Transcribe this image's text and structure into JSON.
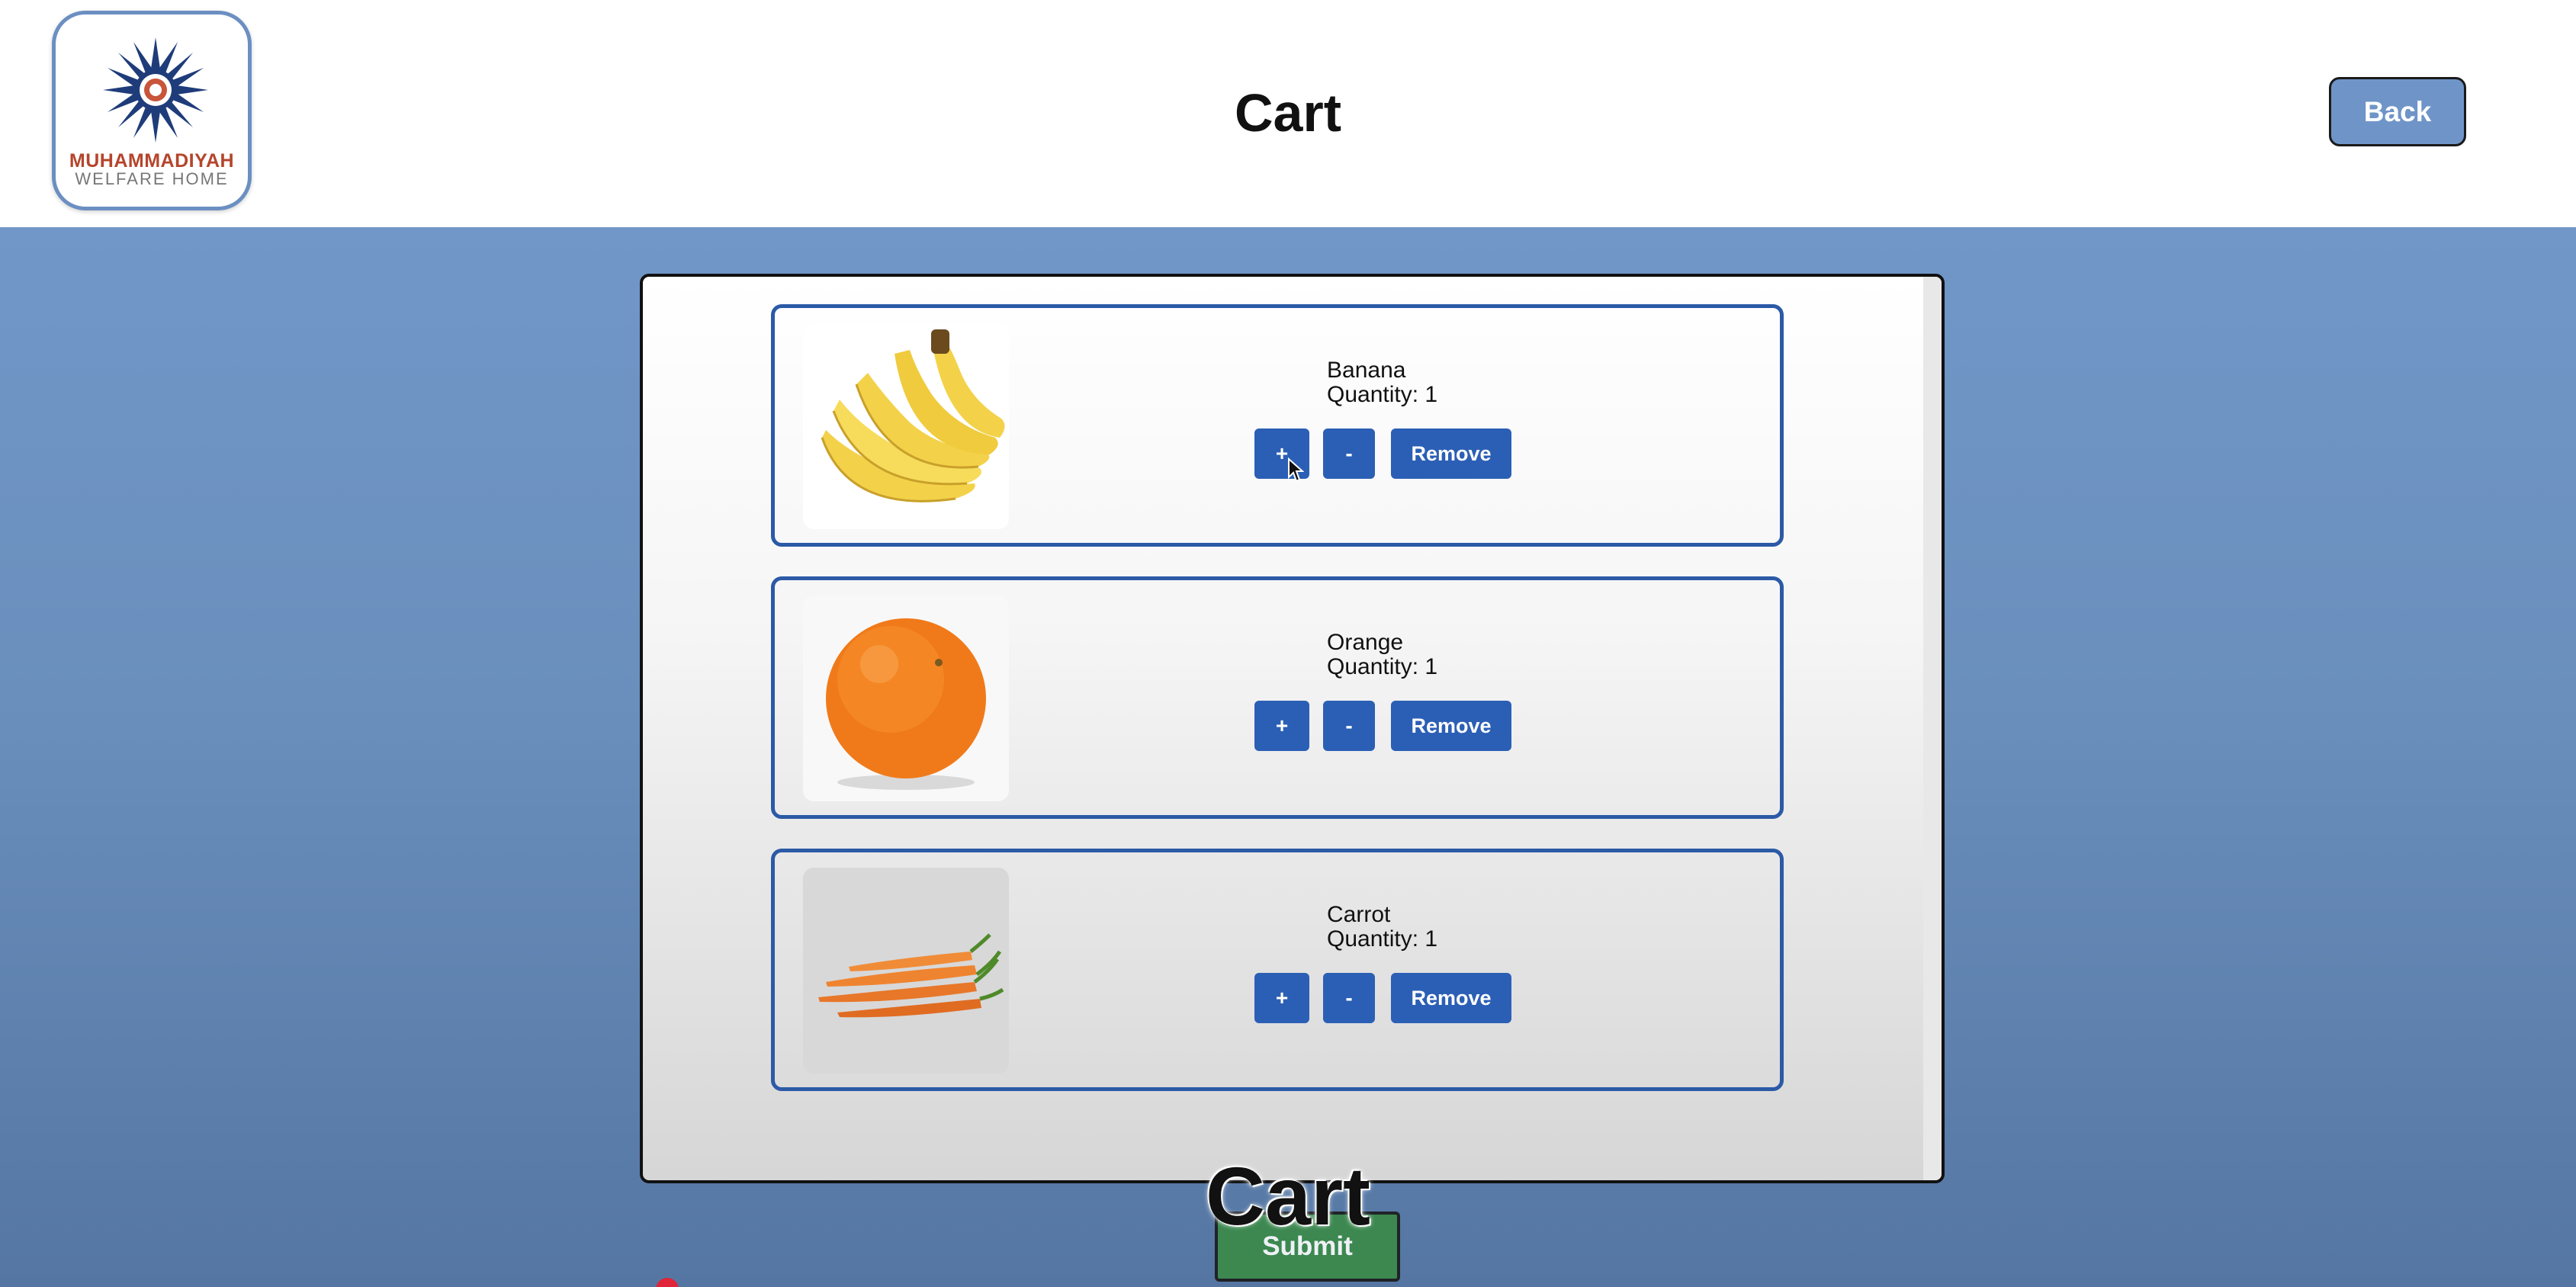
{
  "header": {
    "logo": {
      "line1": "MUHAMMADIYAH",
      "line2": "WELFARE HOME",
      "icon": "sun-emblem-icon"
    },
    "title": "Cart",
    "back_label": "Back"
  },
  "cart": {
    "items": [
      {
        "name": "Banana",
        "quantity_label": "Quantity:",
        "quantity": "1",
        "image": "banana-image"
      },
      {
        "name": "Orange",
        "quantity_label": "Quantity:",
        "quantity": "1",
        "image": "orange-image"
      },
      {
        "name": "Carrot",
        "quantity_label": "Quantity:",
        "quantity": "1",
        "image": "carrot-image"
      }
    ],
    "buttons": {
      "plus": "+",
      "minus": "-",
      "remove": "Remove"
    }
  },
  "footer": {
    "submit_label": "Submit",
    "overlay_caption": "Cart"
  },
  "colors": {
    "primary_button": "#2b5fb5",
    "card_border": "#2b5aa6",
    "back_button": "#6f95c8",
    "submit_button": "#3a8a47",
    "background": "#7097c8"
  }
}
